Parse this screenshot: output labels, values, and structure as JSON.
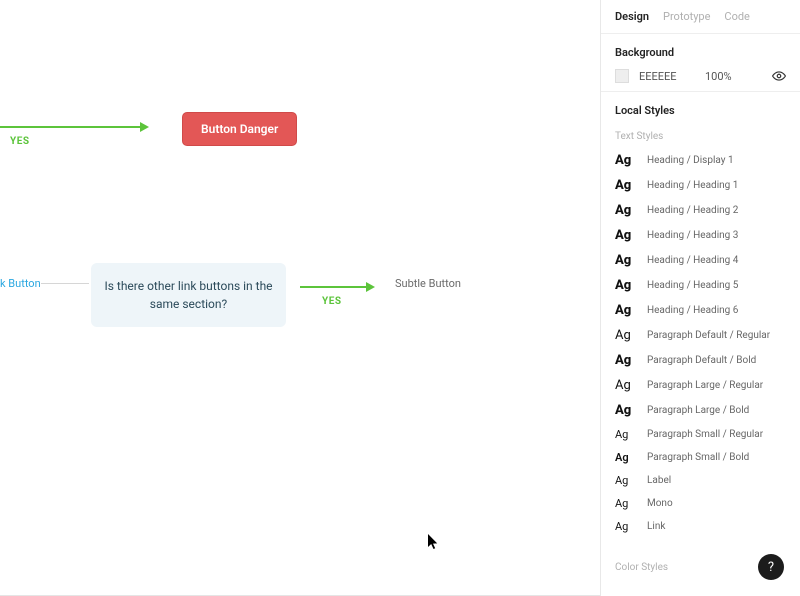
{
  "canvas": {
    "arrow1_label": "YES",
    "danger_button": "Button Danger",
    "link_button_label": "k Button",
    "question": "Is there other link buttons in the same section?",
    "arrow2_label": "YES",
    "subtle_button": "Subtle Button"
  },
  "sidebar": {
    "tabs": {
      "design": "Design",
      "prototype": "Prototype",
      "code": "Code"
    },
    "background": {
      "title": "Background",
      "hex": "EEEEEE",
      "opacity": "100%"
    },
    "local_styles_title": "Local Styles",
    "text_styles_sub": "Text Styles",
    "color_styles_sub": "Color Styles",
    "text_styles": [
      {
        "name": "Heading / Display 1",
        "weight": "bold"
      },
      {
        "name": "Heading / Heading 1",
        "weight": "bold"
      },
      {
        "name": "Heading / Heading 2",
        "weight": "bold"
      },
      {
        "name": "Heading / Heading 3",
        "weight": "bold"
      },
      {
        "name": "Heading / Heading 4",
        "weight": "bold"
      },
      {
        "name": "Heading / Heading 5",
        "weight": "bold"
      },
      {
        "name": "Heading / Heading 6",
        "weight": "bold"
      },
      {
        "name": "Paragraph Default / Regular",
        "weight": "reg"
      },
      {
        "name": "Paragraph Default / Bold",
        "weight": "bold"
      },
      {
        "name": "Paragraph Large / Regular",
        "weight": "reg"
      },
      {
        "name": "Paragraph Large / Bold",
        "weight": "bold"
      },
      {
        "name": "Paragraph Small / Regular",
        "weight": "reg sm"
      },
      {
        "name": "Paragraph Small / Bold",
        "weight": "semi sm"
      },
      {
        "name": "Label",
        "weight": "reg sm"
      },
      {
        "name": "Mono",
        "weight": "reg sm"
      },
      {
        "name": "Link",
        "weight": "reg sm"
      }
    ]
  },
  "help": "?"
}
